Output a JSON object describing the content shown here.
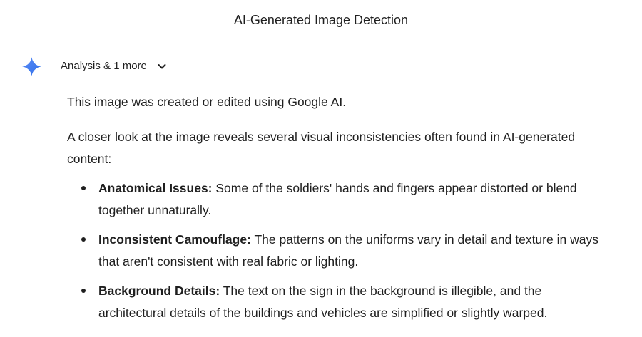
{
  "header": {
    "title": "AI-Generated Image Detection"
  },
  "response": {
    "icon": "gemini-sparkle-icon",
    "tools_label": "Analysis & 1 more",
    "paragraph_1": "This image was created or edited using Google AI.",
    "paragraph_2": "A closer look at the image reveals several visual inconsistencies often found in AI-generated content:",
    "points": [
      {
        "title": "Anatomical Issues:",
        "text": " Some of the soldiers' hands and fingers appear distorted or blend together unnaturally."
      },
      {
        "title": "Inconsistent Camouflage:",
        "text": " The patterns on the uniforms vary in detail and texture in ways that aren't consistent with real fabric or lighting."
      },
      {
        "title": "Background Details:",
        "text": " The text on the sign in the background is illegible, and the architectural details of the buildings and vehicles are simplified or slightly warped."
      }
    ]
  },
  "colors": {
    "text": "#1f1f1f",
    "accent_blue": "#4285f4"
  }
}
